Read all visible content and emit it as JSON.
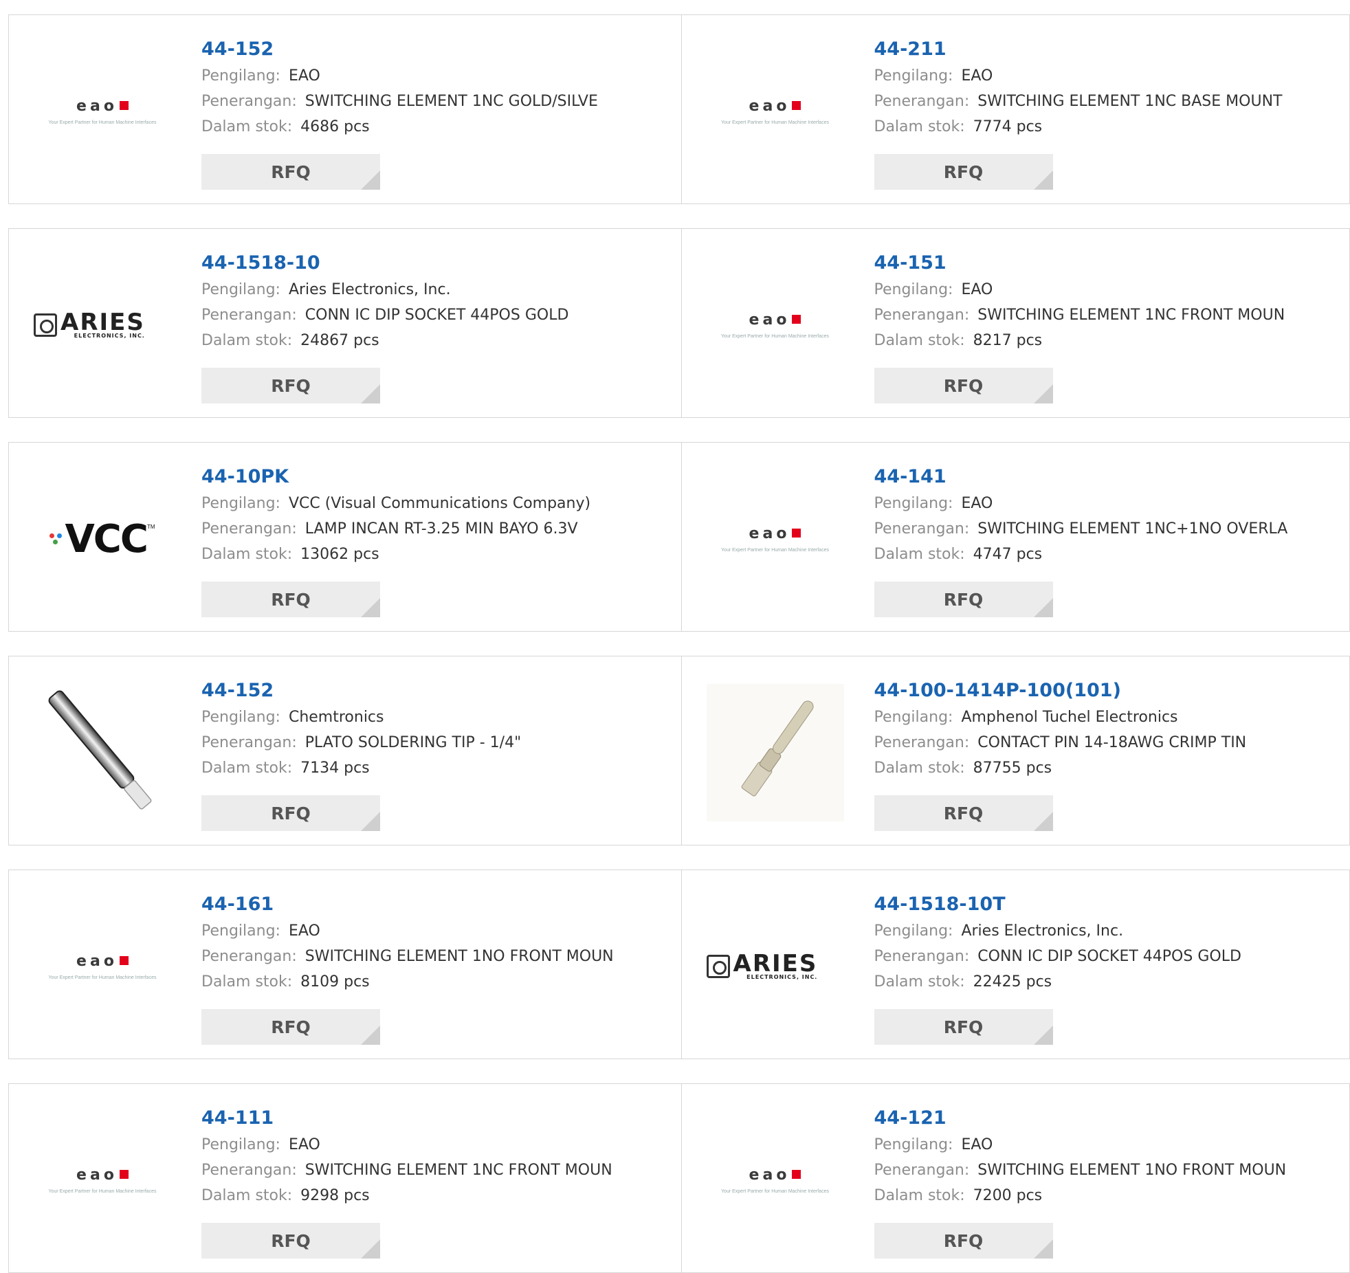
{
  "labels": {
    "manufacturer": "Pengilang:",
    "description": "Penerangan:",
    "stock": "Dalam stok:",
    "rfq": "RFQ"
  },
  "products": [
    {
      "pn": "44-152",
      "mfr": "EAO",
      "desc": "SWITCHING ELEMENT 1NC GOLD/SILVE",
      "stock": "4686 pcs",
      "logo": "eao-logo"
    },
    {
      "pn": "44-211",
      "mfr": "EAO",
      "desc": "SWITCHING ELEMENT 1NC BASE MOUNT",
      "stock": "7774 pcs",
      "logo": "eao-logo"
    },
    {
      "pn": "44-1518-10",
      "mfr": "Aries Electronics, Inc.",
      "desc": "CONN IC DIP SOCKET 44POS GOLD",
      "stock": "24867 pcs",
      "logo": "aries-logo"
    },
    {
      "pn": "44-151",
      "mfr": "EAO",
      "desc": "SWITCHING ELEMENT 1NC FRONT MOUN",
      "stock": "8217 pcs",
      "logo": "eao-logo"
    },
    {
      "pn": "44-10PK",
      "mfr": "VCC (Visual Communications Company)",
      "desc": "LAMP INCAN RT-3.25 MIN BAYO 6.3V",
      "stock": "13062 pcs",
      "logo": "vcc-logo"
    },
    {
      "pn": "44-141",
      "mfr": "EAO",
      "desc": "SWITCHING ELEMENT 1NC+1NO OVERLA",
      "stock": "4747 pcs",
      "logo": "eao-logo"
    },
    {
      "pn": "44-152",
      "mfr": "Chemtronics",
      "desc": "PLATO SOLDERING TIP - 1/4\"",
      "stock": "7134 pcs",
      "logo": "soldering-tip-photo"
    },
    {
      "pn": "44-100-1414P-100(101)",
      "mfr": "Amphenol Tuchel Electronics",
      "desc": "CONTACT PIN 14-18AWG CRIMP TIN",
      "stock": "87755 pcs",
      "logo": "contact-pin-photo"
    },
    {
      "pn": "44-161",
      "mfr": "EAO",
      "desc": "SWITCHING ELEMENT 1NO FRONT MOUN",
      "stock": "8109 pcs",
      "logo": "eao-logo"
    },
    {
      "pn": "44-1518-10T",
      "mfr": "Aries Electronics, Inc.",
      "desc": "CONN IC DIP SOCKET 44POS GOLD",
      "stock": "22425 pcs",
      "logo": "aries-logo"
    },
    {
      "pn": "44-111",
      "mfr": "EAO",
      "desc": "SWITCHING ELEMENT 1NC FRONT MOUN",
      "stock": "9298 pcs",
      "logo": "eao-logo"
    },
    {
      "pn": "44-121",
      "mfr": "EAO",
      "desc": "SWITCHING ELEMENT 1NO FRONT MOUN",
      "stock": "7200 pcs",
      "logo": "eao-logo"
    }
  ],
  "logos": {
    "eao": {
      "word": "eao",
      "tagline": "Your Expert Partner for Human Machine Interfaces",
      "accent": "#e3001b"
    },
    "aries": {
      "word": "ARIES",
      "sub": "ELECTRONICS, INC."
    },
    "vcc": {
      "word": "VCC",
      "tm": "TM",
      "dot_colors": [
        "#e53935",
        "#1e88e5",
        "#43a047"
      ]
    }
  },
  "colors": {
    "link": "#1a63b0",
    "label": "#8d8d8d",
    "button_bg": "#ececec"
  }
}
